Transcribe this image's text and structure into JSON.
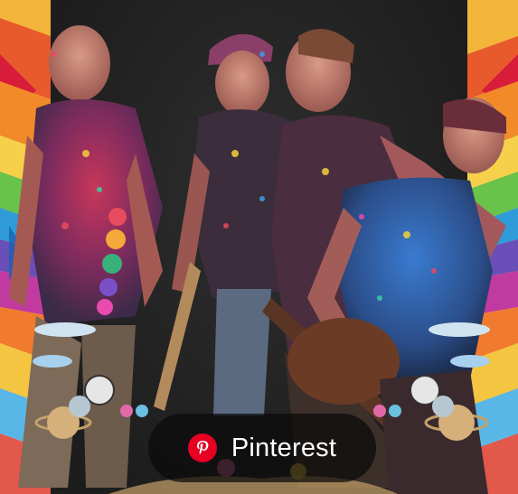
{
  "pin_button": {
    "label": "Pinterest",
    "icon": "pinterest-icon",
    "brand_color": "#e60023"
  },
  "colors": {
    "background": "#232323",
    "pill_background": "rgba(10,10,10,0.72)"
  }
}
